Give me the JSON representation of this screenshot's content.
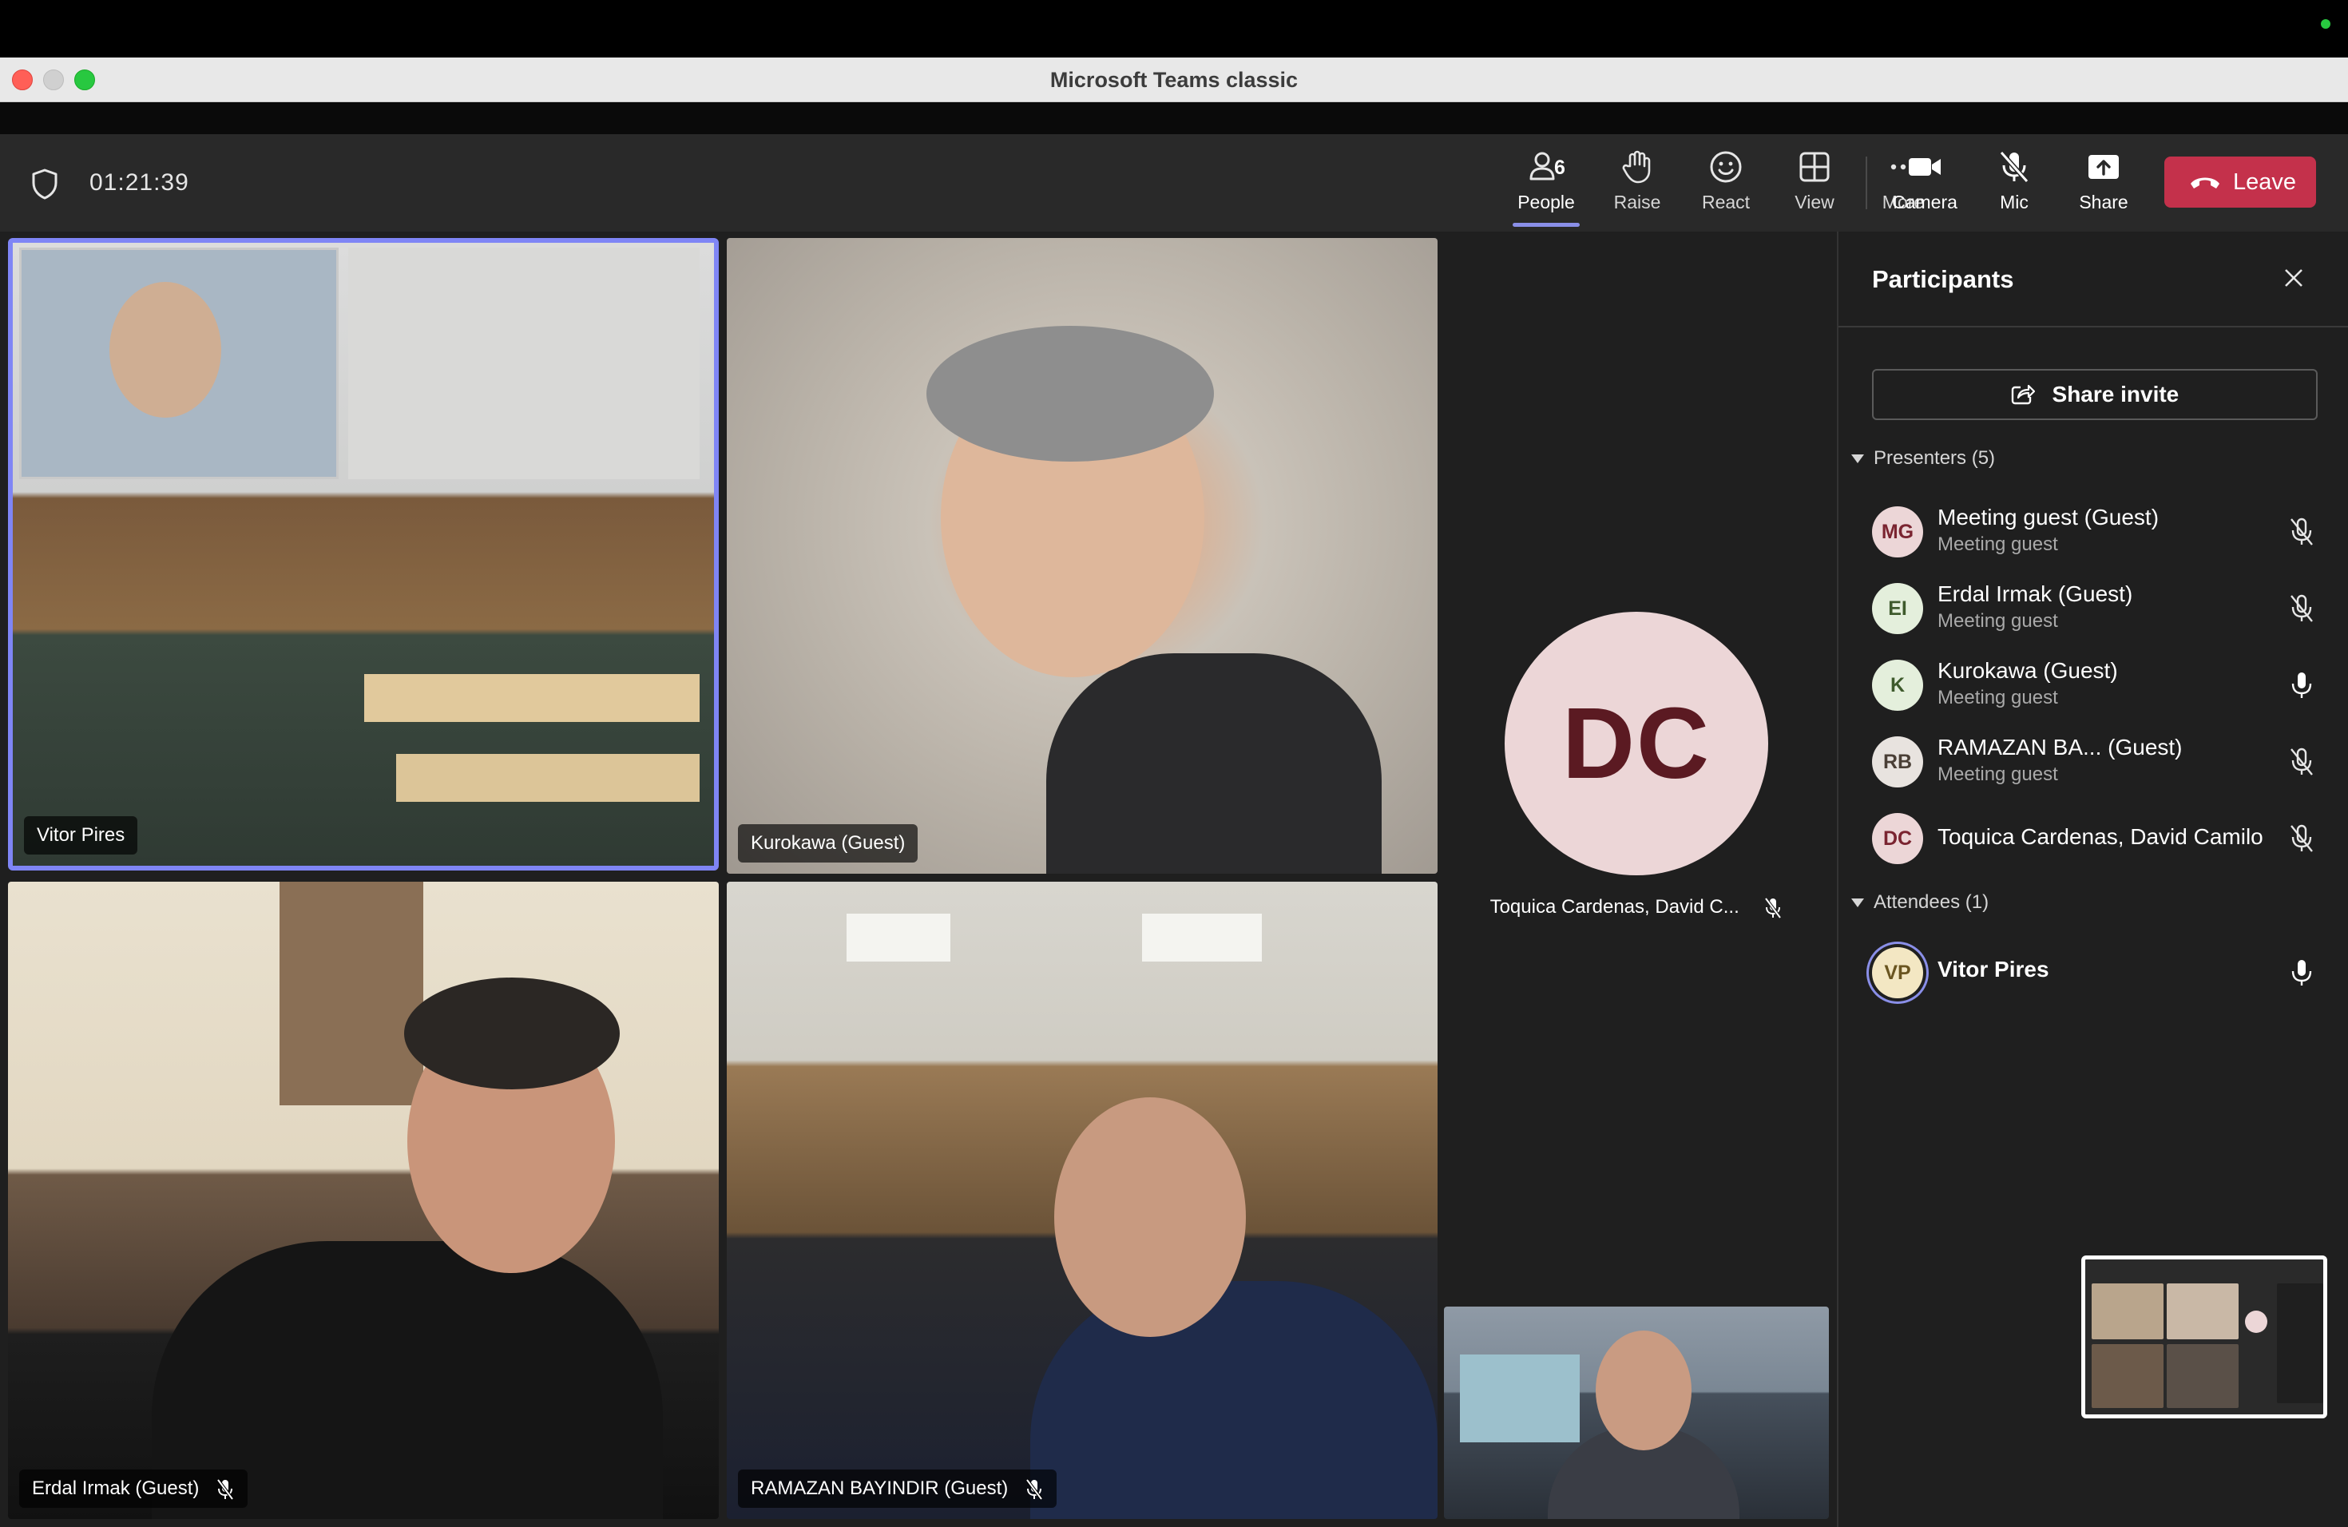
{
  "window": {
    "title": "Microsoft Teams classic"
  },
  "meeting": {
    "timer": "01:21:39"
  },
  "toolbar": {
    "people_label": "People",
    "people_count": "6",
    "raise_label": "Raise",
    "react_label": "React",
    "view_label": "View",
    "more_label": "More",
    "camera_label": "Camera",
    "mic_label": "Mic",
    "share_label": "Share",
    "leave_label": "Leave"
  },
  "stage": {
    "tiles": [
      {
        "name": "Vitor Pires",
        "muted": false,
        "active_speaker": true
      },
      {
        "name": "Kurokawa (Guest)",
        "muted": false
      },
      {
        "name": "Erdal Irmak (Guest)",
        "muted": true
      },
      {
        "name": "RAMAZAN BAYINDIR (Guest)",
        "muted": true
      }
    ],
    "avatar_tile": {
      "initials": "DC",
      "name": "Toquica Cardenas, David C...",
      "muted": true
    }
  },
  "panel": {
    "title": "Participants",
    "share_invite": "Share invite",
    "presenters_label": "Presenters (5)",
    "attendees_label": "Attendees (1)",
    "presenters": [
      {
        "initials": "MG",
        "name": "Meeting guest (Guest)",
        "role": "Meeting guest",
        "muted": true,
        "avatar_bg": "#ecd6d7",
        "avatar_fg": "#7a2430"
      },
      {
        "initials": "EI",
        "name": "Erdal Irmak (Guest)",
        "role": "Meeting guest",
        "muted": true,
        "avatar_bg": "#e4efdc",
        "avatar_fg": "#3e5a2c"
      },
      {
        "initials": "K",
        "name": "Kurokawa (Guest)",
        "role": "Meeting guest",
        "muted": false,
        "avatar_bg": "#e4efdc",
        "avatar_fg": "#3e5a2c"
      },
      {
        "initials": "RB",
        "name": "RAMAZAN BA...  (Guest)",
        "role": "Meeting guest",
        "muted": true,
        "avatar_bg": "#e8e3df",
        "avatar_fg": "#4a3f36"
      },
      {
        "initials": "DC",
        "name": "Toquica Cardenas, David Camilo",
        "role": "",
        "muted": true,
        "avatar_bg": "#ecd6d7",
        "avatar_fg": "#7a2430"
      }
    ],
    "attendees": [
      {
        "initials": "VP",
        "name": "Vitor Pires",
        "muted": false,
        "avatar_bg": "#f3e7c3",
        "avatar_fg": "#6a5520"
      }
    ]
  },
  "colors": {
    "accent": "#7f85f5",
    "leave": "#c4314b",
    "panel_bg": "#1f1f1f",
    "toolbar_bg": "#292929"
  }
}
